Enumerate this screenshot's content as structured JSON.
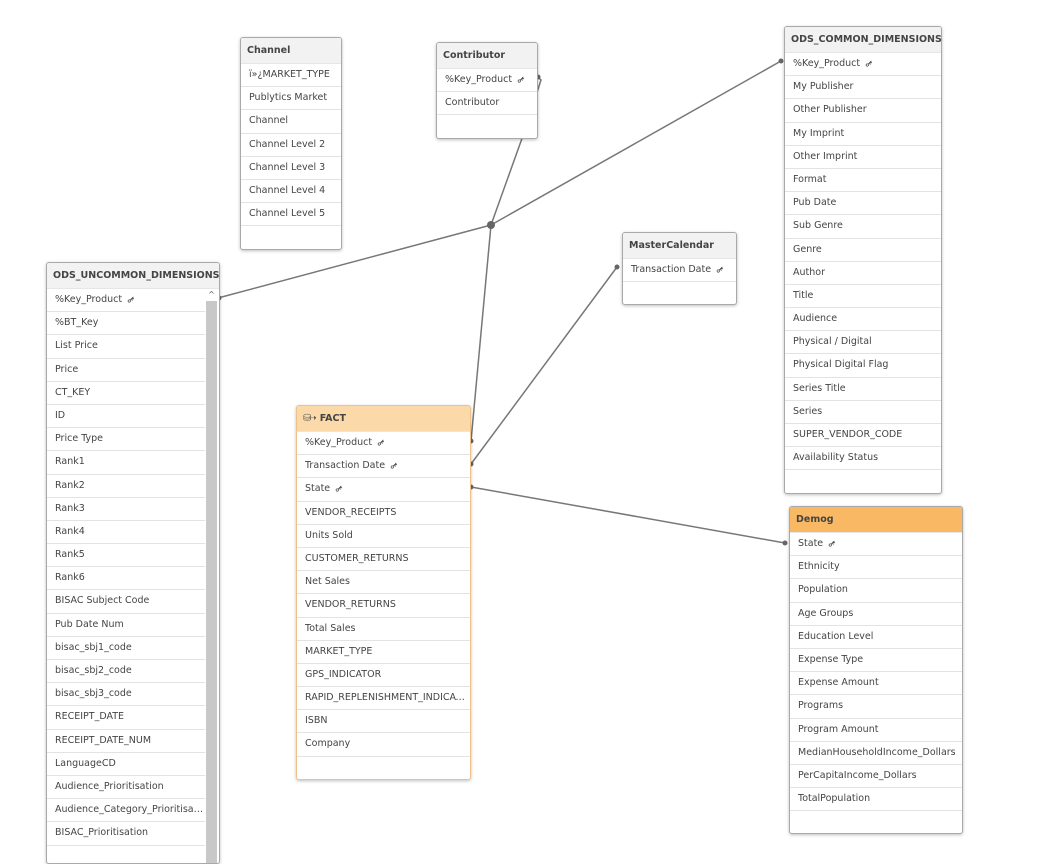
{
  "tables": [
    {
      "id": "channel",
      "title": "Channel",
      "fields": [
        {
          "name": "ï»¿MARKET_TYPE"
        },
        {
          "name": "Publytics Market"
        },
        {
          "name": "Channel"
        },
        {
          "name": "Channel Level 2"
        },
        {
          "name": "Channel Level 3"
        },
        {
          "name": "Channel Level 4"
        },
        {
          "name": "Channel Level 5"
        }
      ]
    },
    {
      "id": "contributor",
      "title": "Contributor",
      "fields": [
        {
          "name": "%Key_Product",
          "key": true
        },
        {
          "name": "Contributor"
        }
      ]
    },
    {
      "id": "ods_common",
      "title": "ODS_COMMON_DIMENSIONS",
      "fields": [
        {
          "name": "%Key_Product",
          "key": true
        },
        {
          "name": "My Publisher"
        },
        {
          "name": "Other Publisher"
        },
        {
          "name": "My Imprint"
        },
        {
          "name": "Other Imprint"
        },
        {
          "name": "Format"
        },
        {
          "name": "Pub Date"
        },
        {
          "name": "Sub Genre"
        },
        {
          "name": "Genre"
        },
        {
          "name": "Author"
        },
        {
          "name": "Title"
        },
        {
          "name": "Audience"
        },
        {
          "name": "Physical / Digital"
        },
        {
          "name": "Physical Digital Flag"
        },
        {
          "name": "Series Title"
        },
        {
          "name": "Series"
        },
        {
          "name": "SUPER_VENDOR_CODE"
        },
        {
          "name": "Availability Status"
        }
      ]
    },
    {
      "id": "mastercalendar",
      "title": "MasterCalendar",
      "fields": [
        {
          "name": "Transaction Date",
          "key": true
        }
      ]
    },
    {
      "id": "ods_uncommon",
      "title": "ODS_UNCOMMON_DIMENSIONS",
      "scrollable": true,
      "fields": [
        {
          "name": "%Key_Product",
          "key": true
        },
        {
          "name": "%BT_Key"
        },
        {
          "name": "List Price"
        },
        {
          "name": "Price"
        },
        {
          "name": "CT_KEY"
        },
        {
          "name": "ID"
        },
        {
          "name": "Price Type"
        },
        {
          "name": "Rank1"
        },
        {
          "name": "Rank2"
        },
        {
          "name": "Rank3"
        },
        {
          "name": "Rank4"
        },
        {
          "name": "Rank5"
        },
        {
          "name": "Rank6"
        },
        {
          "name": "BISAC Subject Code"
        },
        {
          "name": "Pub Date Num"
        },
        {
          "name": "bisac_sbj1_code"
        },
        {
          "name": "bisac_sbj2_code"
        },
        {
          "name": "bisac_sbj3_code"
        },
        {
          "name": "RECEIPT_DATE"
        },
        {
          "name": "RECEIPT_DATE_NUM"
        },
        {
          "name": "LanguageCD"
        },
        {
          "name": "Audience_Prioritisation"
        },
        {
          "name": "Audience_Category_Prioritisation"
        },
        {
          "name": "BISAC_Prioritisation"
        }
      ]
    },
    {
      "id": "fact",
      "title": "FACT",
      "icon": "database-icon",
      "fields": [
        {
          "name": "%Key_Product",
          "key": true
        },
        {
          "name": "Transaction Date",
          "key": true
        },
        {
          "name": "State",
          "key": true
        },
        {
          "name": "VENDOR_RECEIPTS"
        },
        {
          "name": "Units Sold"
        },
        {
          "name": "CUSTOMER_RETURNS"
        },
        {
          "name": "Net Sales"
        },
        {
          "name": "VENDOR_RETURNS"
        },
        {
          "name": "Total Sales"
        },
        {
          "name": "MARKET_TYPE"
        },
        {
          "name": "GPS_INDICATOR"
        },
        {
          "name": "RAPID_REPLENISHMENT_INDICATOR"
        },
        {
          "name": "ISBN"
        },
        {
          "name": "Company"
        }
      ]
    },
    {
      "id": "demog",
      "title": "Demog",
      "fields": [
        {
          "name": "State",
          "key": true
        },
        {
          "name": "Ethnicity"
        },
        {
          "name": "Population"
        },
        {
          "name": "Age Groups"
        },
        {
          "name": "Education Level"
        },
        {
          "name": "Expense Type"
        },
        {
          "name": "Expense Amount"
        },
        {
          "name": "Programs"
        },
        {
          "name": "Program Amount"
        },
        {
          "name": "MedianHouseholdIncome_Dollars"
        },
        {
          "name": "PerCapitaIncome_Dollars"
        },
        {
          "name": "TotalPopulation"
        }
      ]
    }
  ],
  "colors": {
    "fact_header": "#fcd9a8",
    "demog_header": "#f9b864",
    "link": "#777777"
  }
}
